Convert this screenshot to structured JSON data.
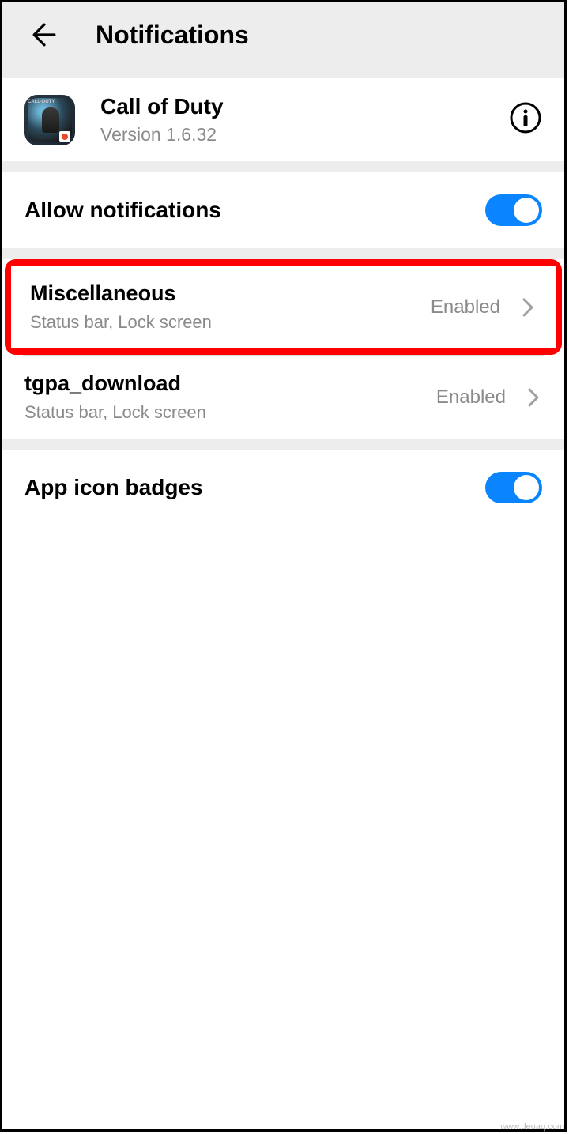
{
  "header": {
    "title": "Notifications"
  },
  "app": {
    "name": "Call of Duty",
    "version": "Version 1.6.32",
    "iconLabel": "CALL-DUTY"
  },
  "allowNotifications": {
    "label": "Allow notifications",
    "enabled": true
  },
  "channels": [
    {
      "title": "Miscellaneous",
      "subtitle": "Status bar, Lock screen",
      "status": "Enabled",
      "highlighted": true
    },
    {
      "title": "tgpa_download",
      "subtitle": "Status bar, Lock screen",
      "status": "Enabled",
      "highlighted": false
    }
  ],
  "appIconBadges": {
    "label": "App icon badges",
    "enabled": true
  },
  "watermark": "www.deuaq.com"
}
